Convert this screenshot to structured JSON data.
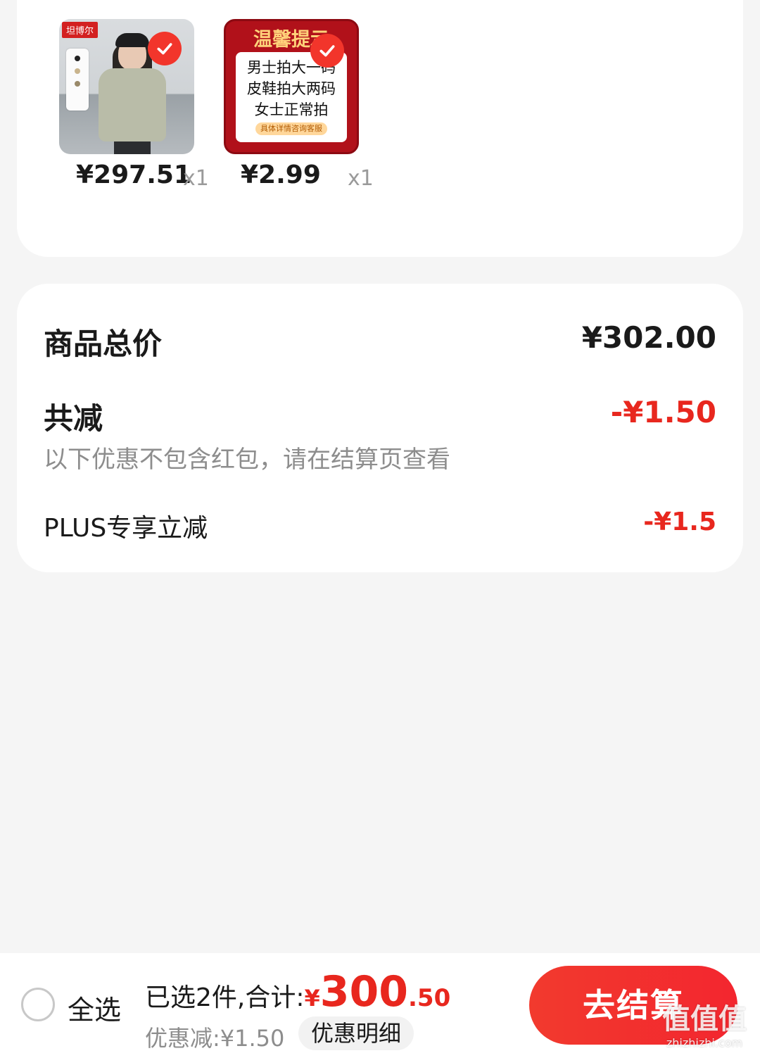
{
  "products": [
    {
      "image": "coat-product-photo",
      "brand_tag": "坦博尔",
      "price_int": "¥297",
      "price_dec": ".51",
      "qty": "x1",
      "selected": true
    },
    {
      "image": "size-notice-card",
      "notice_title": "温馨提示",
      "notice_lines": [
        "男士拍大一码",
        "皮鞋拍大两码",
        "女士正常拍"
      ],
      "notice_footer": "具体详情咨询客服",
      "price_int": "¥2",
      "price_dec": ".99",
      "qty": "x1",
      "selected": true
    }
  ],
  "summary": {
    "total_label": "商品总价",
    "total_value": "¥302.00",
    "reduce_label": "共减",
    "reduce_value": "-¥1.50",
    "reduce_note": "以下优惠不包含红包，请在结算页查看",
    "plus_label": "PLUS专享立减",
    "plus_value": "-¥1.5"
  },
  "bottom_bar": {
    "select_all_label": "全选",
    "select_all_checked": false,
    "sum_prefix": "已选2件,合计:",
    "sum_yen": "¥",
    "sum_int": "300",
    "sum_dec": ".50",
    "discount_text": "优惠减:¥1.50",
    "detail_label": "优惠明细",
    "checkout_label": "去结算"
  },
  "watermark": {
    "main": "值值值",
    "sub": "zhizhizhi.com"
  },
  "colors": {
    "accent_red": "#e8271e",
    "check_red": "#f2352b",
    "muted_text": "#8d8d8d",
    "card_bg": "#ffffff",
    "page_bg": "#f5f5f5"
  },
  "icons": {
    "checkmark": "check-icon"
  }
}
